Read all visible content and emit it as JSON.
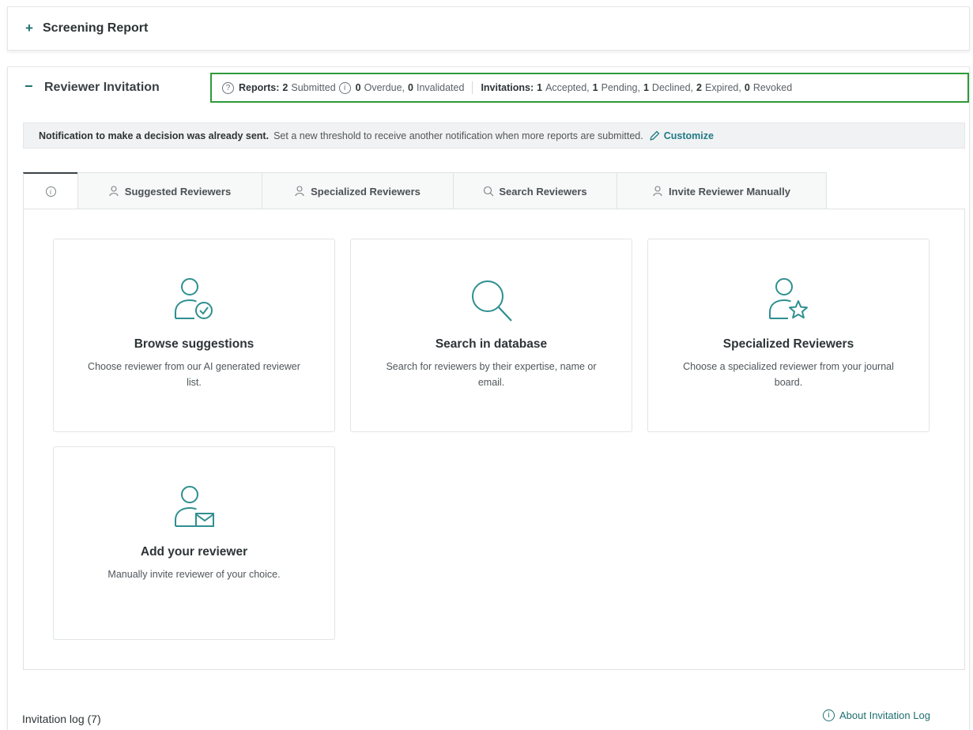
{
  "screening": {
    "toggle": "+",
    "title": "Screening Report"
  },
  "reviewer_invitation": {
    "toggle": "−",
    "title": "Reviewer Invitation",
    "stats": {
      "reports_label": "Reports:",
      "submitted_count": "2",
      "submitted_label": "Submitted",
      "overdue_count": "0",
      "overdue_label": "Overdue,",
      "invalidated_count": "0",
      "invalidated_label": "Invalidated",
      "invitations_label": "Invitations:",
      "accepted_count": "1",
      "accepted_label": "Accepted,",
      "pending_count": "1",
      "pending_label": "Pending,",
      "declined_count": "1",
      "declined_label": "Declined,",
      "expired_count": "2",
      "expired_label": "Expired,",
      "revoked_count": "0",
      "revoked_label": "Revoked",
      "help_icon_glyph": "?",
      "info_icon_glyph": "i"
    },
    "notice": {
      "bold": "Notification to make a decision was already sent.",
      "text": "Set a new threshold to receive another notification when more reports are submitted.",
      "link": "Customize"
    },
    "tabs": [
      {
        "label": "",
        "icon": "info-icon",
        "info_glyph": "i"
      },
      {
        "label": "Suggested Reviewers",
        "icon": "user-icon"
      },
      {
        "label": "Specialized Reviewers",
        "icon": "user-icon"
      },
      {
        "label": "Search Reviewers",
        "icon": "search-icon"
      },
      {
        "label": "Invite Reviewer Manually",
        "icon": "user-icon"
      }
    ],
    "cards": [
      {
        "title": "Browse suggestions",
        "desc": "Choose reviewer from our AI generated reviewer list.",
        "icon": "user-check-icon"
      },
      {
        "title": "Search in database",
        "desc": "Search for reviewers by their expertise, name or email.",
        "icon": "search-icon"
      },
      {
        "title": "Specialized Reviewers",
        "desc": "Choose a specialized reviewer from your journal board.",
        "icon": "user-star-icon"
      },
      {
        "title": "Add your reviewer",
        "desc": "Manually invite reviewer of your choice.",
        "icon": "user-mail-icon"
      }
    ]
  },
  "invitation_log": {
    "title": "Invitation log (7)",
    "about": "About Invitation Log",
    "info_glyph": "i"
  },
  "colors": {
    "accent": "#1f6f70",
    "highlight_border": "#2e9a3a"
  }
}
